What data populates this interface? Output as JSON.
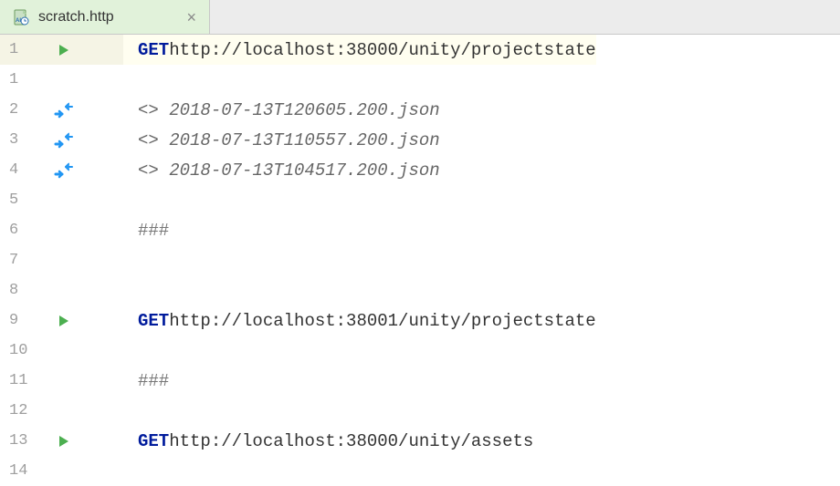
{
  "tab": {
    "label": "scratch.http",
    "icon": "http-file-icon"
  },
  "lines": [
    {
      "num": "1",
      "icon": "run",
      "type": "request",
      "method": "GET",
      "url": "http://localhost:38000/unity/projectstate",
      "highlighted": true
    },
    {
      "num": "1",
      "icon": "",
      "type": "blank",
      "text": ""
    },
    {
      "num": "2",
      "icon": "link",
      "type": "response",
      "text": "<> 2018-07-13T120605.200.json"
    },
    {
      "num": "3",
      "icon": "link",
      "type": "response",
      "text": "<> 2018-07-13T110557.200.json"
    },
    {
      "num": "4",
      "icon": "link",
      "type": "response",
      "text": "<> 2018-07-13T104517.200.json"
    },
    {
      "num": "5",
      "icon": "",
      "type": "blank",
      "text": ""
    },
    {
      "num": "6",
      "icon": "",
      "type": "separator",
      "text": "###"
    },
    {
      "num": "7",
      "icon": "",
      "type": "blank",
      "text": ""
    },
    {
      "num": "8",
      "icon": "",
      "type": "blank",
      "text": ""
    },
    {
      "num": "9",
      "icon": "run",
      "type": "request",
      "method": "GET",
      "url": "http://localhost:38001/unity/projectstate"
    },
    {
      "num": "10",
      "icon": "",
      "type": "blank",
      "text": ""
    },
    {
      "num": "11",
      "icon": "",
      "type": "separator",
      "text": "###"
    },
    {
      "num": "12",
      "icon": "",
      "type": "blank",
      "text": ""
    },
    {
      "num": "13",
      "icon": "run",
      "type": "request",
      "method": "GET",
      "url": "http://localhost:38000/unity/assets"
    },
    {
      "num": "14",
      "icon": "",
      "type": "blank",
      "text": ""
    }
  ]
}
